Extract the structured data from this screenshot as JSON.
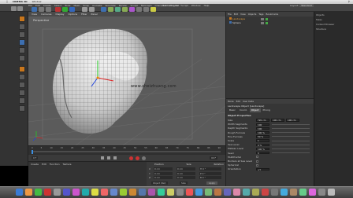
{
  "mac_menubar": {
    "app": "CINEMA 4D",
    "menu": "Window",
    "right": [
      "Spotlight"
    ]
  },
  "window": {
    "title": "Untitled 1.c4d *"
  },
  "app_menu": [
    "File",
    "Edit",
    "Create",
    "Select",
    "Tools",
    "Mesh",
    "Snap",
    "Animate",
    "Simulate",
    "Render",
    "Sculpt",
    "MoGraph",
    "Character",
    "Plugins",
    "Script",
    "Window",
    "Help"
  ],
  "layout": {
    "label": "Layout:",
    "value": "Standard"
  },
  "viewport": {
    "menu": [
      "View",
      "Cameras",
      "Display",
      "Options",
      "Filter",
      "Panel"
    ],
    "label": "Perspective",
    "watermark": "www.sheizhuang.com"
  },
  "timeline": {
    "ticks": [
      "0",
      "5",
      "10",
      "15",
      "20",
      "25",
      "30",
      "35",
      "40",
      "45",
      "50",
      "55",
      "60",
      "65",
      "70",
      "75",
      "80",
      "85",
      "90"
    ],
    "start": "0 F",
    "end": "90 F"
  },
  "materials": {
    "menu": [
      "Create",
      "Edit",
      "Function",
      "Texture"
    ]
  },
  "coordinates": {
    "headers": [
      "Position",
      "Size",
      "Rotation"
    ],
    "rows": [
      {
        "axis": "X",
        "pos": "0 cm",
        "size": "0 cm",
        "rot": "H 0 °"
      },
      {
        "axis": "Y",
        "pos": "0 cm",
        "size": "0 cm",
        "rot": "P 0 °"
      },
      {
        "axis": "Z",
        "pos": "0 cm",
        "size": "0 cm",
        "rot": "B 0 °"
      }
    ],
    "mode": "Object (Rel)",
    "size_mode": "Size",
    "apply": "Apply"
  },
  "objects_panel": {
    "tabs": [
      "Objects",
      "Takes",
      "Content Browser",
      "Structure"
    ],
    "menu": [
      "File",
      "Edit",
      "View",
      "Objects",
      "Tags",
      "Bookmarks"
    ],
    "items": [
      {
        "name": "Landscape"
      },
      {
        "name": "Sphere"
      }
    ]
  },
  "attributes_panel": {
    "menu": [
      "Mode",
      "Edit",
      "User Data"
    ],
    "object_title": "Landscape Object [Landscape]",
    "tabs": [
      "Basic",
      "Coord.",
      "Object",
      "Phong"
    ],
    "section": "Object Properties",
    "rows": [
      {
        "label": "Size",
        "values": [
          "720 cm",
          "100 cm",
          "100 cm"
        ]
      },
      {
        "label": "Width Segments",
        "values": [
          "100"
        ]
      },
      {
        "label": "Depth Segments",
        "values": [
          "100"
        ]
      },
      {
        "label": "Rough Furrows",
        "values": [
          "100 %"
        ]
      },
      {
        "label": "Fine Furrows",
        "values": [
          "50 %"
        ]
      },
      {
        "label": "Scale",
        "values": [
          "1"
        ]
      },
      {
        "label": "Sea Level",
        "values": [
          "0 %"
        ]
      },
      {
        "label": "Plateau Level",
        "values": [
          "100 %"
        ]
      },
      {
        "label": "Seed",
        "values": [
          "0"
        ]
      }
    ],
    "checks": [
      "Multifractal",
      "Borders at Sea Level",
      "Spherical"
    ],
    "orientation_label": "Orientation",
    "orientation_value": "+Y"
  },
  "colors": {
    "accent": "#c8761c",
    "selected_blue": "#3d6fb0",
    "viewport_bg": "#5b5b5b",
    "panel_bg": "#363636"
  }
}
